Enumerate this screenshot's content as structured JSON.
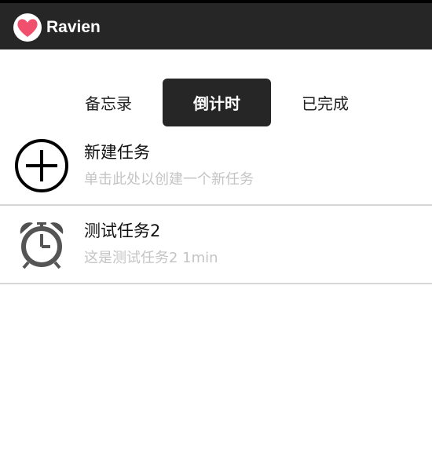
{
  "app": {
    "title": "Ravien",
    "accent": "#262626",
    "icon": "heart-icon"
  },
  "tabs": [
    {
      "label": "备忘录",
      "active": false
    },
    {
      "label": "倒计时",
      "active": true
    },
    {
      "label": "已完成",
      "active": false
    }
  ],
  "list": [
    {
      "title": "新建任务",
      "subtitle": "单击此处以创建一个新任务",
      "icon": "add-circle-icon"
    },
    {
      "title": "测试任务2",
      "subtitle": "这是测试任务2 1min",
      "icon": "alarm-clock-icon"
    }
  ]
}
